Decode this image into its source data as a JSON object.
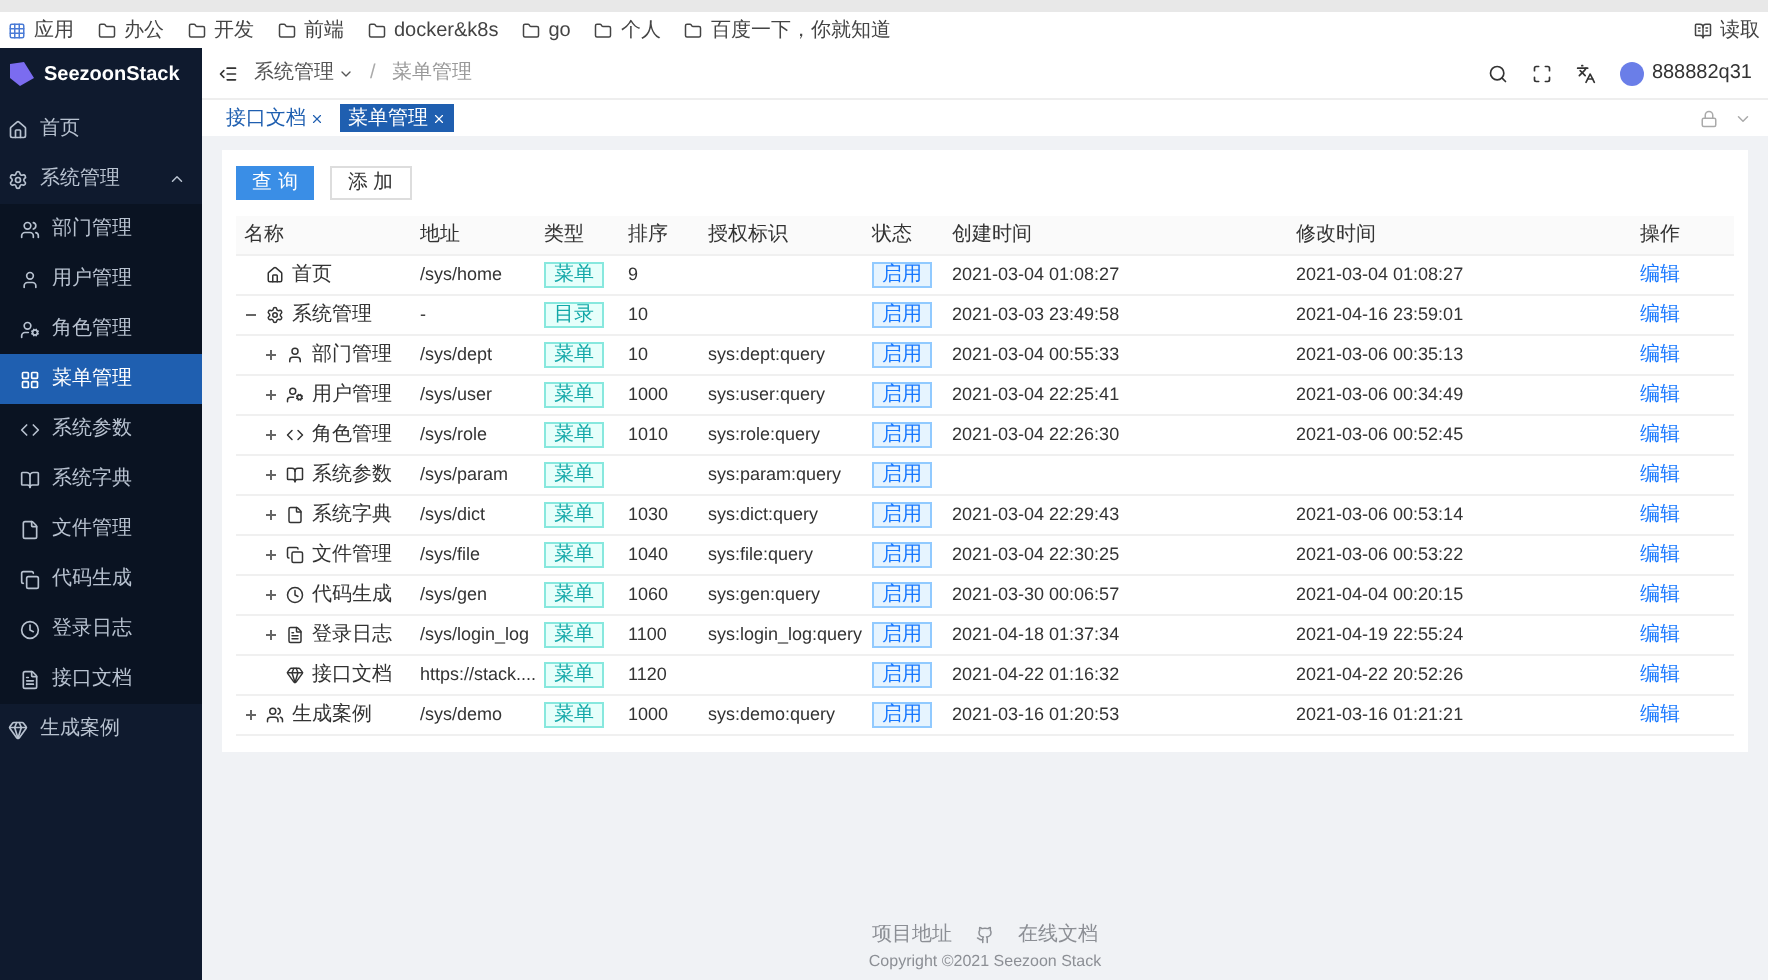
{
  "bookmarks": [
    "应用",
    "办公",
    "开发",
    "前端",
    "docker&k8s",
    "go",
    "个人",
    "百度一下，你就知道"
  ],
  "reading_mode": "读取",
  "sidebar": {
    "logo": "SeezoonStack",
    "items": [
      {
        "label": "首页",
        "selected": false
      },
      {
        "label": "系统管理",
        "selected": false,
        "expanded": true,
        "children": [
          {
            "label": "部门管理",
            "selected": false
          },
          {
            "label": "用户管理",
            "selected": false
          },
          {
            "label": "角色管理",
            "selected": false
          },
          {
            "label": "菜单管理",
            "selected": true
          },
          {
            "label": "系统参数",
            "selected": false
          },
          {
            "label": "系统字典",
            "selected": false
          },
          {
            "label": "文件管理",
            "selected": false
          },
          {
            "label": "代码生成",
            "selected": false
          },
          {
            "label": "登录日志",
            "selected": false
          },
          {
            "label": "接口文档",
            "selected": false
          }
        ]
      },
      {
        "label": "生成案例",
        "selected": false
      }
    ]
  },
  "header": {
    "breadcrumb": [
      "系统管理",
      "菜单管理"
    ],
    "separator": "/",
    "user": "888882q31"
  },
  "tabs": [
    {
      "label": "接口文档",
      "selected": false
    },
    {
      "label": "菜单管理",
      "selected": true
    }
  ],
  "buttons": [
    {
      "label": "查 询",
      "kind": "primary"
    },
    {
      "label": "添 加",
      "kind": "default"
    }
  ],
  "table": {
    "columns": [
      "名称",
      "地址",
      "类型",
      "排序",
      "授权标识",
      "状态",
      "创建时间",
      "修改时间",
      "操作"
    ],
    "rows": [
      {
        "name": "首页",
        "path": "/sys/home",
        "type": "菜单",
        "order": "9",
        "status": "启用",
        "created": "2021-03-04 01:08:27",
        "modified": "2021-03-04 01:08:27",
        "action": "编辑"
      },
      {
        "name": "系统管理",
        "path": "-",
        "type": "目录",
        "order": "10",
        "status": "启用",
        "created": "2021-03-03 23:49:58",
        "modified": "2021-04-16 23:59:01",
        "action": "编辑",
        "expanded": true,
        "children": [
          {
            "name": "部门管理",
            "path": "/sys/dept",
            "type": "菜单",
            "order": "10",
            "permission": "sys:dept:query",
            "status": "启用",
            "created": "2021-03-04 00:55:33",
            "modified": "2021-03-06 00:35:13",
            "action": "编辑",
            "expanded": false
          },
          {
            "name": "用户管理",
            "path": "/sys/user",
            "type": "菜单",
            "order": "1000",
            "permission": "sys:user:query",
            "status": "启用",
            "created": "2021-03-04 22:25:41",
            "modified": "2021-03-06 00:34:49",
            "action": "编辑",
            "expanded": false
          },
          {
            "name": "角色管理",
            "path": "/sys/role",
            "type": "菜单",
            "order": "1010",
            "permission": "sys:role:query",
            "status": "启用",
            "created": "2021-03-04 22:26:30",
            "modified": "2021-03-06 00:52:45",
            "action": "编辑",
            "expanded": false
          },
          {
            "name": "系统参数",
            "path": "/sys/param",
            "type": "菜单",
            "permission": "sys:param:query",
            "status": "启用",
            "action": "编辑",
            "expanded": false
          },
          {
            "name": "系统字典",
            "path": "/sys/dict",
            "type": "菜单",
            "order": "1030",
            "permission": "sys:dict:query",
            "status": "启用",
            "created": "2021-03-04 22:29:43",
            "modified": "2021-03-06 00:53:14",
            "action": "编辑",
            "expanded": false
          },
          {
            "name": "文件管理",
            "path": "/sys/file",
            "type": "菜单",
            "order": "1040",
            "permission": "sys:file:query",
            "status": "启用",
            "created": "2021-03-04 22:30:25",
            "modified": "2021-03-06 00:53:22",
            "action": "编辑",
            "expanded": false
          },
          {
            "name": "代码生成",
            "path": "/sys/gen",
            "type": "菜单",
            "order": "1060",
            "permission": "sys:gen:query",
            "status": "启用",
            "created": "2021-03-30 00:06:57",
            "modified": "2021-04-04 00:20:15",
            "action": "编辑",
            "expanded": false
          },
          {
            "name": "登录日志",
            "path": "/sys/login_log",
            "type": "菜单",
            "order": "1100",
            "permission": "sys:login_log:query",
            "status": "启用",
            "created": "2021-04-18 01:37:34",
            "modified": "2021-04-19 22:55:24",
            "action": "编辑",
            "expanded": false
          },
          {
            "name": "接口文档",
            "path": "https://stack....",
            "type": "菜单",
            "order": "1120",
            "status": "启用",
            "created": "2021-04-22 01:16:32",
            "modified": "2021-04-22 20:52:26",
            "action": "编辑"
          }
        ]
      },
      {
        "name": "生成案例",
        "path": "/sys/demo",
        "type": "菜单",
        "order": "1000",
        "permission": "sys:demo:query",
        "status": "启用",
        "created": "2021-03-16 01:20:53",
        "modified": "2021-03-16 01:21:21",
        "action": "编辑",
        "expanded": false
      }
    ]
  },
  "footer": {
    "links": [
      "项目地址",
      "在线文档"
    ],
    "copyright": "Copyright ©2021 Seezoon Stack"
  }
}
